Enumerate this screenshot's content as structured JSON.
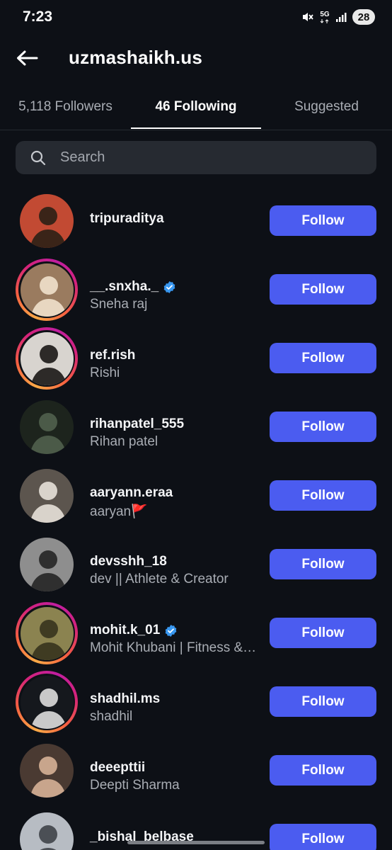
{
  "status_bar": {
    "time": "7:23",
    "network": "5G",
    "battery": "28"
  },
  "header": {
    "title": "uzmashaikh.us"
  },
  "tabs": [
    {
      "label": "5,118 Followers",
      "active": false
    },
    {
      "label": "46 Following",
      "active": true
    },
    {
      "label": "Suggested",
      "active": false
    }
  ],
  "search": {
    "placeholder": "Search",
    "value": ""
  },
  "accent_color": "#4b5cf0",
  "users": [
    {
      "username": "tripuraditya",
      "name": "",
      "verified": false,
      "story_ring": false,
      "button": "Follow",
      "bg": "#c24a33",
      "fg": "#3a2418"
    },
    {
      "username": "__.snxha._",
      "name": "Sneha raj",
      "verified": true,
      "story_ring": true,
      "button": "Follow",
      "bg": "#9a7b5f",
      "fg": "#e8d7c1"
    },
    {
      "username": "ref.rish",
      "name": "Rishi",
      "verified": false,
      "story_ring": true,
      "button": "Follow",
      "bg": "#d8d4cf",
      "fg": "#2d2a28"
    },
    {
      "username": "rihanpatel_555",
      "name": "Rihan patel",
      "verified": false,
      "story_ring": false,
      "button": "Follow",
      "bg": "#1d241d",
      "fg": "#4b5a48"
    },
    {
      "username": "aaryann.eraa",
      "name": "aaryan🚩",
      "verified": false,
      "story_ring": false,
      "button": "Follow",
      "bg": "#5c554e",
      "fg": "#d9d3cb"
    },
    {
      "username": "devsshh_18",
      "name": "dev || Athlete & Creator",
      "verified": false,
      "story_ring": false,
      "button": "Follow",
      "bg": "#8e8e8e",
      "fg": "#2f2f2f"
    },
    {
      "username": "mohit.k_01",
      "name": "Mohit Khubani | Fitness & Lifestyle",
      "verified": true,
      "story_ring": true,
      "button": "Follow",
      "bg": "#8b8350",
      "fg": "#3f3b22"
    },
    {
      "username": "shadhil.ms",
      "name": "  shadhil",
      "verified": false,
      "story_ring": true,
      "button": "Follow",
      "bg": "#15181d",
      "fg": "#c9c9c9"
    },
    {
      "username": "deeepttii",
      "name": "Deepti Sharma",
      "verified": false,
      "story_ring": false,
      "button": "Follow",
      "bg": "#4a3a32",
      "fg": "#c8a58c"
    },
    {
      "username": "_bishal_belbase_",
      "name": "",
      "verified": false,
      "story_ring": false,
      "button": "Follow",
      "bg": "#b7bcc3",
      "fg": "#4b4f55"
    }
  ]
}
